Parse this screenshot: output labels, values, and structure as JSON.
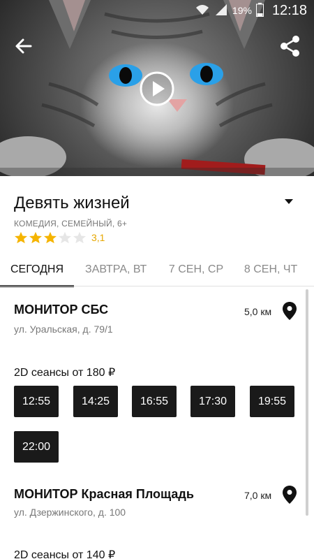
{
  "status_bar": {
    "battery": "19%",
    "time": "12:18"
  },
  "movie": {
    "title": "Девять жизней",
    "genre": "КОМЕДИЯ, СЕМЕЙНЫЙ, 6+",
    "rating_value": "3,1",
    "stars_filled": 3,
    "stars_total": 5
  },
  "tabs": [
    {
      "label": "СЕГОДНЯ",
      "active": true
    },
    {
      "label": "ЗАВТРА, ВТ",
      "active": false
    },
    {
      "label": "7 СЕН, СР",
      "active": false
    },
    {
      "label": "8 СЕН, ЧТ",
      "active": false
    }
  ],
  "cinemas": [
    {
      "name": "МОНИТОР СБС",
      "address": "ул. Уральская, д. 79/1",
      "distance": "5,0 км",
      "format_label": "2D сеансы от 180 ₽",
      "times": [
        "12:55",
        "14:25",
        "16:55",
        "17:30",
        "19:55",
        "22:00"
      ]
    },
    {
      "name": "МОНИТОР Красная Площадь",
      "address": "ул. Дзержинского, д. 100",
      "distance": "7,0 км",
      "format_label": "2D сеансы от 140 ₽",
      "times": []
    }
  ],
  "icons": {
    "back": "arrow-back-icon",
    "share": "share-icon",
    "play": "play-icon",
    "dropdown": "caret-down-icon",
    "location": "location-pin-icon",
    "star": "star-icon"
  },
  "colors": {
    "star_filled": "#f5b400",
    "star_empty": "#e6e6e6",
    "rating_text": "#e6a700",
    "showtime_bg": "#1a1a1a"
  }
}
